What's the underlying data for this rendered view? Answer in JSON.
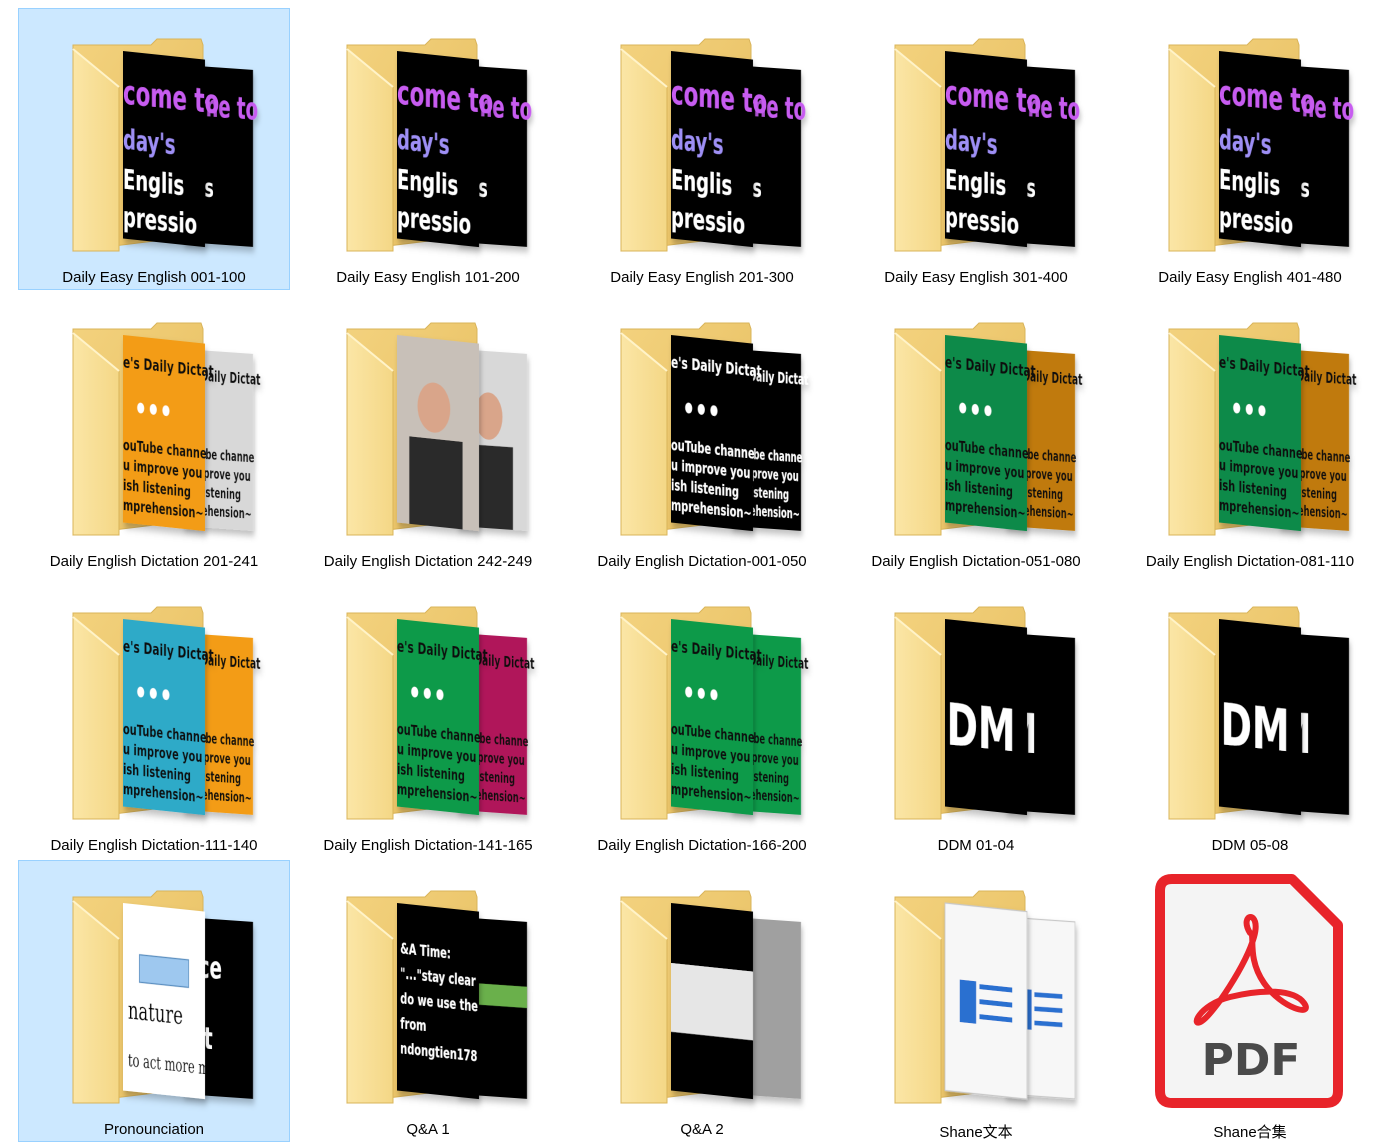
{
  "items": [
    {
      "label": "Daily Easy English 001-100",
      "selected": true,
      "kind": "folder",
      "preview": "welcome",
      "back": "#000000",
      "front": "#000000"
    },
    {
      "label": "Daily Easy English 101-200",
      "selected": false,
      "kind": "folder",
      "preview": "welcome",
      "back": "#000000",
      "front": "#000000"
    },
    {
      "label": "Daily Easy English 201-300",
      "selected": false,
      "kind": "folder",
      "preview": "welcome",
      "back": "#000000",
      "front": "#000000"
    },
    {
      "label": "Daily Easy English 301-400",
      "selected": false,
      "kind": "folder",
      "preview": "welcome",
      "back": "#000000",
      "front": "#000000"
    },
    {
      "label": "Daily Easy English 401-480",
      "selected": false,
      "kind": "folder",
      "preview": "welcome",
      "back": "#000000",
      "front": "#000000"
    },
    {
      "label": "Daily English Dictation 201-241",
      "selected": false,
      "kind": "folder",
      "preview": "dictation",
      "back": "#d8d8d8",
      "front": "#f39c12"
    },
    {
      "label": "Daily English Dictation 242-249",
      "selected": false,
      "kind": "folder",
      "preview": "photo",
      "back": "#d8d8d8",
      "front": "#c8c0b8"
    },
    {
      "label": "Daily English Dictation-001-050",
      "selected": false,
      "kind": "folder",
      "preview": "dictation",
      "back": "#000000",
      "front": "#000000"
    },
    {
      "label": "Daily English Dictation-051-080",
      "selected": false,
      "kind": "folder",
      "preview": "dictation",
      "back": "#c07a10",
      "front": "#0a8a4a"
    },
    {
      "label": "Daily English Dictation-081-110",
      "selected": false,
      "kind": "folder",
      "preview": "dictation",
      "back": "#c07a10",
      "front": "#0a8a4a"
    },
    {
      "label": "Daily English Dictation-111-140",
      "selected": false,
      "kind": "folder",
      "preview": "dictation",
      "back": "#f39c12",
      "front": "#2eaac8"
    },
    {
      "label": "Daily English Dictation-141-165",
      "selected": false,
      "kind": "folder",
      "preview": "dictation",
      "back": "#b0185a",
      "front": "#0a9a4a"
    },
    {
      "label": "Daily English Dictation-166-200",
      "selected": false,
      "kind": "folder",
      "preview": "dictation",
      "back": "#0a9a4a",
      "front": "#0a9a4a"
    },
    {
      "label": "DDM 01-04",
      "selected": false,
      "kind": "folder",
      "preview": "ddm",
      "back": "#000000",
      "front": "#000000"
    },
    {
      "label": "DDM 05-08",
      "selected": false,
      "kind": "folder",
      "preview": "ddm",
      "back": "#000000",
      "front": "#000000"
    },
    {
      "label": "Pronounciation",
      "selected": true,
      "kind": "folder",
      "preview": "pron",
      "back": "#000000",
      "front": "#ffffff"
    },
    {
      "label": "Q&A 1",
      "selected": false,
      "kind": "folder",
      "preview": "qa",
      "back": "#000000",
      "front": "#000000"
    },
    {
      "label": "Q&A 2",
      "selected": false,
      "kind": "folder",
      "preview": "qa2",
      "back": "#a0a0a0",
      "front": "#000000"
    },
    {
      "label": "Shane文本",
      "selected": false,
      "kind": "folder",
      "preview": "docs",
      "back": "#ffffff",
      "front": "#ffffff"
    },
    {
      "label": "Shane合集",
      "selected": false,
      "kind": "pdf",
      "pdf_text": "PDF"
    }
  ],
  "colors": {
    "folder_back": "#e8c570",
    "folder_front": "#f8dc8a",
    "folder_edge": "#d9b45a",
    "selection_bg": "#cce8ff",
    "selection_border": "#99d1ff",
    "pdf_red": "#e8242a"
  }
}
